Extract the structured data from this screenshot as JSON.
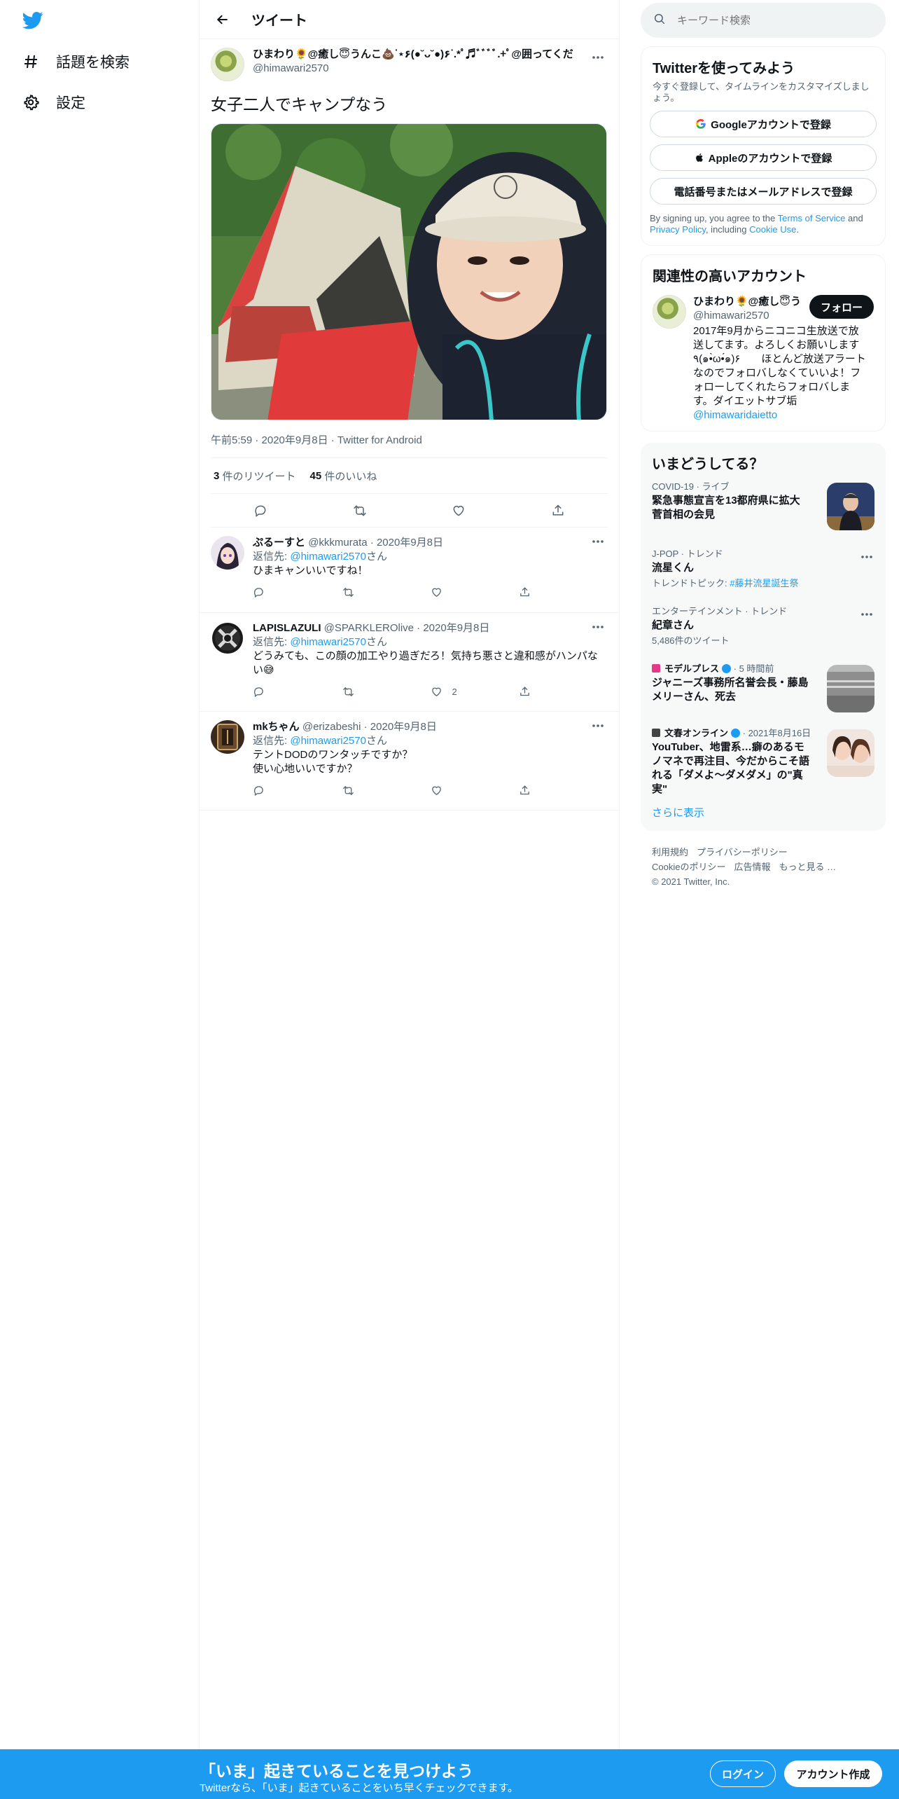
{
  "nav": {
    "items": [
      {
        "label": "話題を検索",
        "icon": "hashtag-icon"
      },
      {
        "label": "設定",
        "icon": "gear-icon"
      }
    ]
  },
  "header": {
    "title": "ツイート"
  },
  "tweet": {
    "author_name": "ひまわり🌻@癒し😇うんこ💩ᐝ⋆۶(●˘ᴗ˘●)۶ᐝ.*ﾟ♬ﾞﾞﾞﾞ.+ﾟ@囲ってくだ",
    "author_handle": "@himawari2570",
    "text": "女子二人でキャンプなう",
    "meta": "午前5:59 · 2020年9月8日 · Twitter for Android",
    "retweets": "3",
    "retweets_label": "件のリツイート",
    "likes": "45",
    "likes_label": "件のいいね"
  },
  "replies": [
    {
      "name": "ぷるーすと",
      "handle": "@kkkmurata",
      "date": "· 2020年9月8日",
      "reply_prefix": "返信先: ",
      "reply_to": "@himawari2570",
      "reply_suffix": "さん",
      "lines": [
        "ひまキャンいいですね！"
      ],
      "like_count": ""
    },
    {
      "name": "LAPISLAZULI",
      "handle": "@SPARKLEROlive",
      "date": "· 2020年9月8日",
      "reply_prefix": "返信先: ",
      "reply_to": "@himawari2570",
      "reply_suffix": "さん",
      "lines": [
        "どうみても、この顔の加工やり過ぎだろ！気持ち悪さと違和感がハンパな",
        "い😅"
      ],
      "like_count": "2"
    },
    {
      "name": "mkちゃん",
      "handle": "@erizabeshi",
      "date": "· 2020年9月8日",
      "reply_prefix": "返信先: ",
      "reply_to": "@himawari2570",
      "reply_suffix": "さん",
      "lines": [
        "テントDODのワンタッチですか？",
        "使い心地いいですか？"
      ],
      "like_count": ""
    }
  ],
  "search": {
    "placeholder": "キーワード検索"
  },
  "signup": {
    "title": "Twitterを使ってみよう",
    "subtitle": "今すぐ登録して、タイムラインをカスタマイズしましょう。",
    "google": "Googleアカウントで登録",
    "apple": "Appleのアカウントで登録",
    "phone": "電話番号またはメールアドレスで登録",
    "legal_1": "By signing up, you agree to the ",
    "tos": "Terms of Service",
    "legal_2": " and ",
    "privacy": "Privacy Policy",
    "legal_3": ", including ",
    "cookie": "Cookie Use",
    "legal_4": "."
  },
  "related": {
    "title": "関連性の高いアカウント",
    "name": "ひまわり🌻@癒し😇うんこ",
    "handle": "@himawari2570",
    "follow": "フォロー",
    "bio_1": "2017年9月からニコニコ生放送で放送してます。よろしくお願いします٩(๑•̀ω•́๑)۶　　ほとんど放送アラートなのでフォロバしなくていいよ！フォローしてくれたらフォロバします。ダイエットサブ垢",
    "bio_link": "@himawaridaietto"
  },
  "trends": {
    "title": "いまどうしてる？",
    "items": [
      {
        "context": "COVID-19 · ライブ",
        "title": "緊急事態宣言を13都府県に拡大 菅首相の会見",
        "sub": ""
      },
      {
        "context": "J-POP · トレンド",
        "title": "流星くん",
        "sub_prefix": "トレンドトピック: ",
        "sub_link": "#藤井流星誕生祭"
      },
      {
        "context": "エンターテインメント · トレンド",
        "title": "紀章さん",
        "sub": "5,486件のツイート"
      },
      {
        "context_source": "モデルプレス",
        "context_time": " · 5 時間前",
        "title": "ジャニーズ事務所名誉会長・藤島メリーさん、死去"
      },
      {
        "context_source": "文春オンライン",
        "context_time": " · 2021年8月16日",
        "title": "YouTuber、地雷系…癖のあるモノマネで再注目、今だからこそ語れる「ダメよ〜ダメダメ」の\"真実\""
      }
    ],
    "show_more": "さらに表示"
  },
  "footer": {
    "terms": "利用規約",
    "privacy": "プライバシーポリシー",
    "cookie": "Cookieのポリシー",
    "ads": "広告情報",
    "more": "もっと見る …",
    "copyright": "© 2021 Twitter, Inc."
  },
  "bottom": {
    "title": "「いま」起きていることを見つけよう",
    "subtitle": "Twitterなら、「いま」起きていることをいち早くチェックできます。",
    "login": "ログイン",
    "signup": "アカウント作成"
  },
  "colors": {
    "accent": "#1d9bf0",
    "text": "#0f1419",
    "muted": "#536471"
  }
}
